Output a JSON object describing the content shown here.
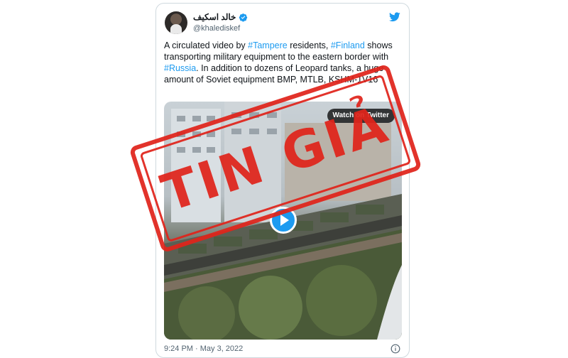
{
  "tweet": {
    "display_name": "خالد اسكيف",
    "handle": "@khalediskef",
    "text_parts": [
      {
        "text": "A circulated video by ",
        "type": "text"
      },
      {
        "text": "#Tampere",
        "type": "hashtag"
      },
      {
        "text": " residents, ",
        "type": "text"
      },
      {
        "text": "#Finland",
        "type": "hashtag"
      },
      {
        "text": " shows transporting military equipment to the eastern border with ",
        "type": "text"
      },
      {
        "text": "#Russia",
        "type": "hashtag"
      },
      {
        "text": ". In addition to dozens of Leopard tanks, a huge amount of Soviet equipment BMP, MTLB, KSHM-1V16",
        "type": "text"
      }
    ],
    "media": {
      "watch_label": "Watch on Twitter"
    },
    "timestamp": "9:24 PM · May 3, 2022"
  },
  "stamp": {
    "text": "TIN GIẢ",
    "color": "#e0241b"
  },
  "icons": {
    "verified": "verified-badge-icon",
    "brand": "twitter-bird-icon",
    "info": "info-icon",
    "play": "play-icon"
  },
  "colors": {
    "link": "#1d9bf0",
    "text": "#0f1419",
    "muted": "#536471"
  }
}
